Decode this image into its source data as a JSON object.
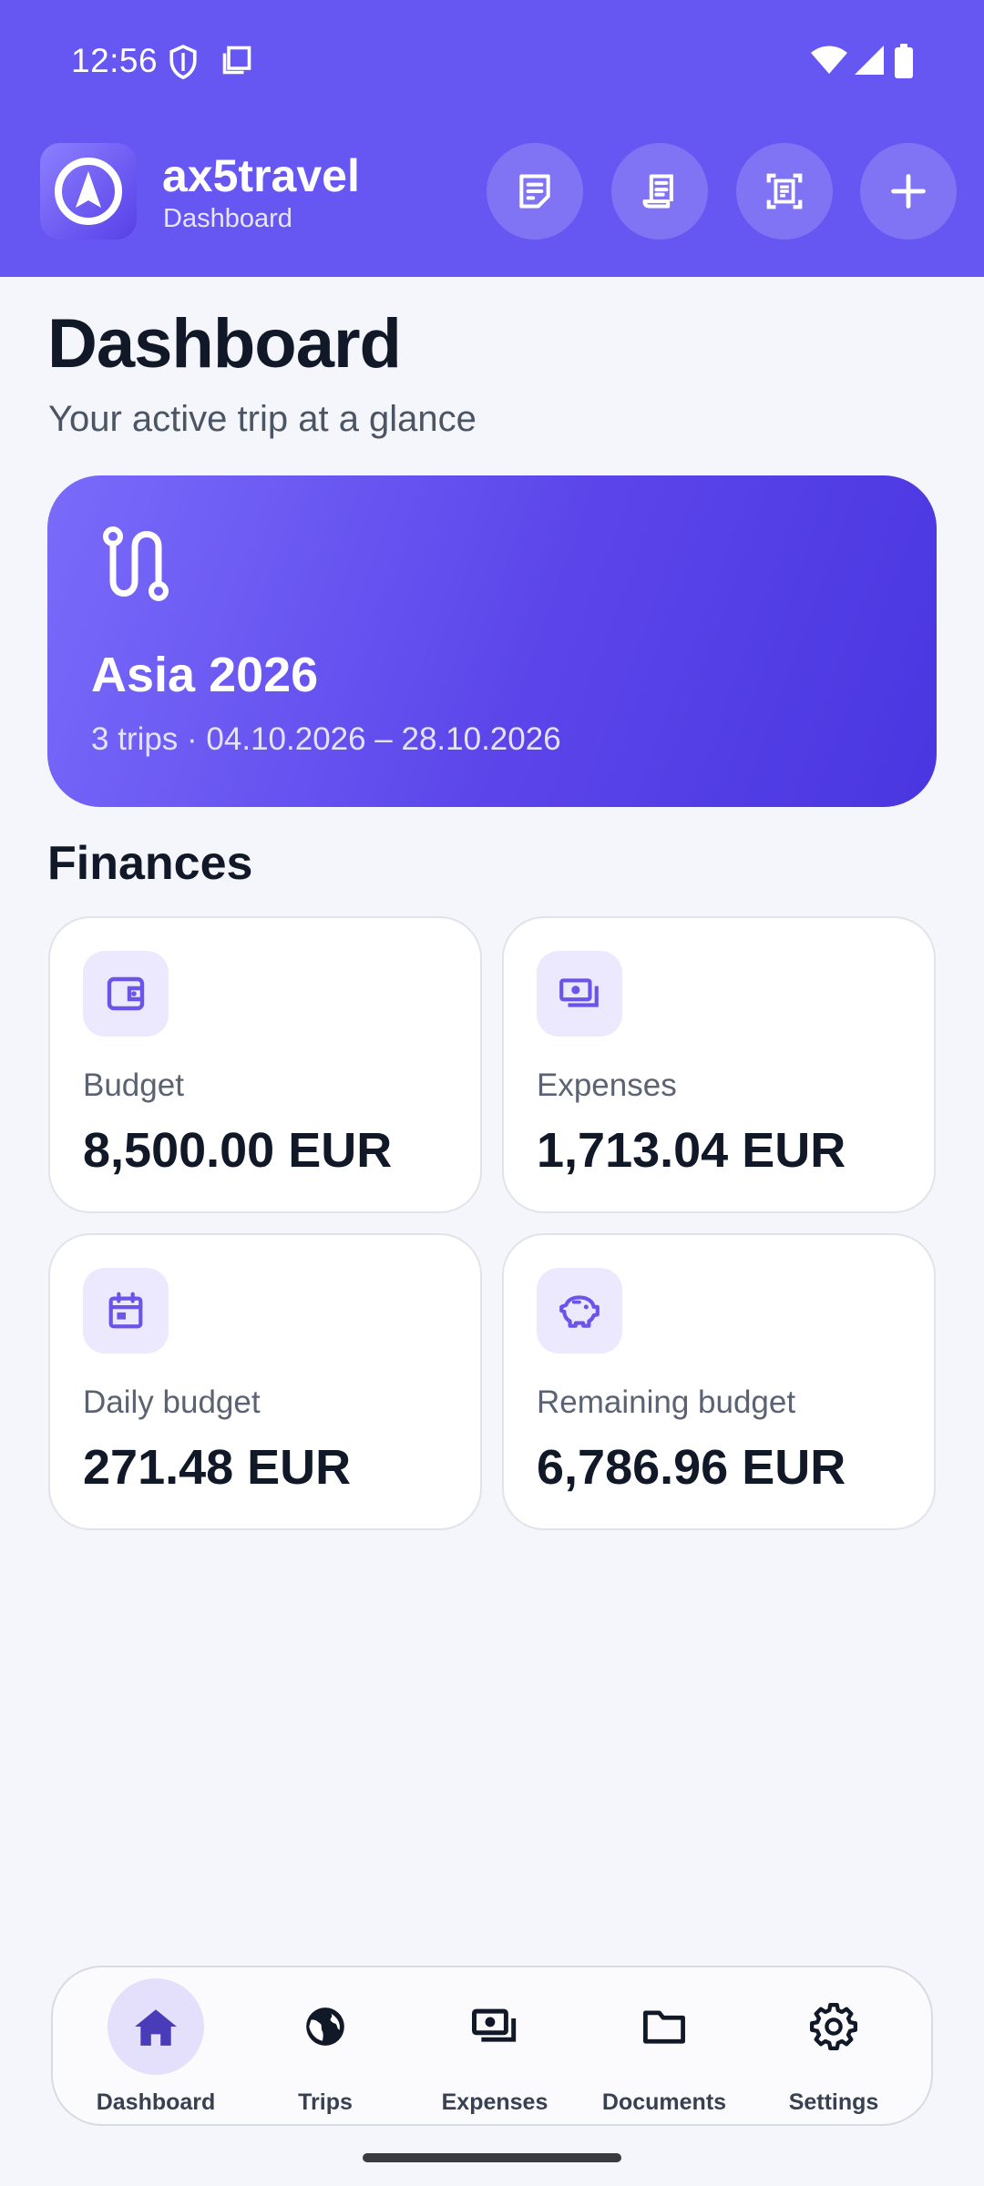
{
  "status_bar": {
    "time": "12:56",
    "icons": [
      "shield-icon",
      "screenshot-icon",
      "wifi-icon",
      "signal-icon",
      "battery-icon"
    ]
  },
  "app_bar": {
    "title": "ax5travel",
    "subtitle": "Dashboard",
    "logo_icon": "navigation-arrow-icon",
    "actions": [
      "note-icon",
      "receipt-icon",
      "scan-document-icon",
      "add-icon"
    ]
  },
  "page": {
    "title": "Dashboard",
    "subtitle": "Your active trip at a glance"
  },
  "active_trip": {
    "icon": "route-icon",
    "name": "Asia 2026",
    "meta": "3 trips · 04.10.2026 – 28.10.2026"
  },
  "finances": {
    "title": "Finances",
    "cards": [
      {
        "label": "Budget",
        "value": "8,500.00 EUR",
        "icon": "wallet-icon"
      },
      {
        "label": "Expenses",
        "value": "1,713.04 EUR",
        "icon": "cash-icon"
      },
      {
        "label": "Daily budget",
        "value": "271.48 EUR",
        "icon": "calendar-icon"
      },
      {
        "label": "Remaining budget",
        "value": "6,786.96 EUR",
        "icon": "piggy-bank-icon"
      }
    ]
  },
  "bottom_nav": {
    "items": [
      {
        "label": "Dashboard",
        "icon": "home-icon",
        "active": true
      },
      {
        "label": "Trips",
        "icon": "globe-icon",
        "active": false
      },
      {
        "label": "Expenses",
        "icon": "cash-icon",
        "active": false
      },
      {
        "label": "Documents",
        "icon": "folder-icon",
        "active": false
      },
      {
        "label": "Settings",
        "icon": "gear-icon",
        "active": false
      }
    ]
  },
  "colors": {
    "primary": "#6656f2",
    "background": "#f5f6fb",
    "icon_tint": "#6b55e8",
    "text_dark": "#111827"
  }
}
